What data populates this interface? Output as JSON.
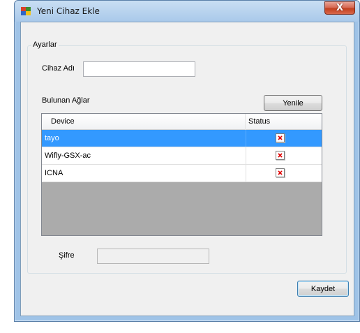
{
  "window": {
    "title": "Yeni Cihaz Ekle",
    "close_symbol": "X"
  },
  "group": {
    "legend": "Ayarlar"
  },
  "form": {
    "device_name_label": "Cihaz Adı",
    "device_name_value": "",
    "networks_label": "Bulunan Ağlar",
    "refresh_label": "Yenile",
    "password_label": "Şifre",
    "password_value": "",
    "save_label": "Kaydet"
  },
  "grid": {
    "columns": [
      "Device",
      "Status"
    ],
    "rows": [
      {
        "device": "tayo",
        "status": "error",
        "selected": true
      },
      {
        "device": "Wifly-GSX-ac",
        "status": "error",
        "selected": false
      },
      {
        "device": "ICNA",
        "status": "error",
        "selected": false
      }
    ]
  },
  "colors": {
    "selection": "#3399ff",
    "status_x": "#e00000"
  }
}
